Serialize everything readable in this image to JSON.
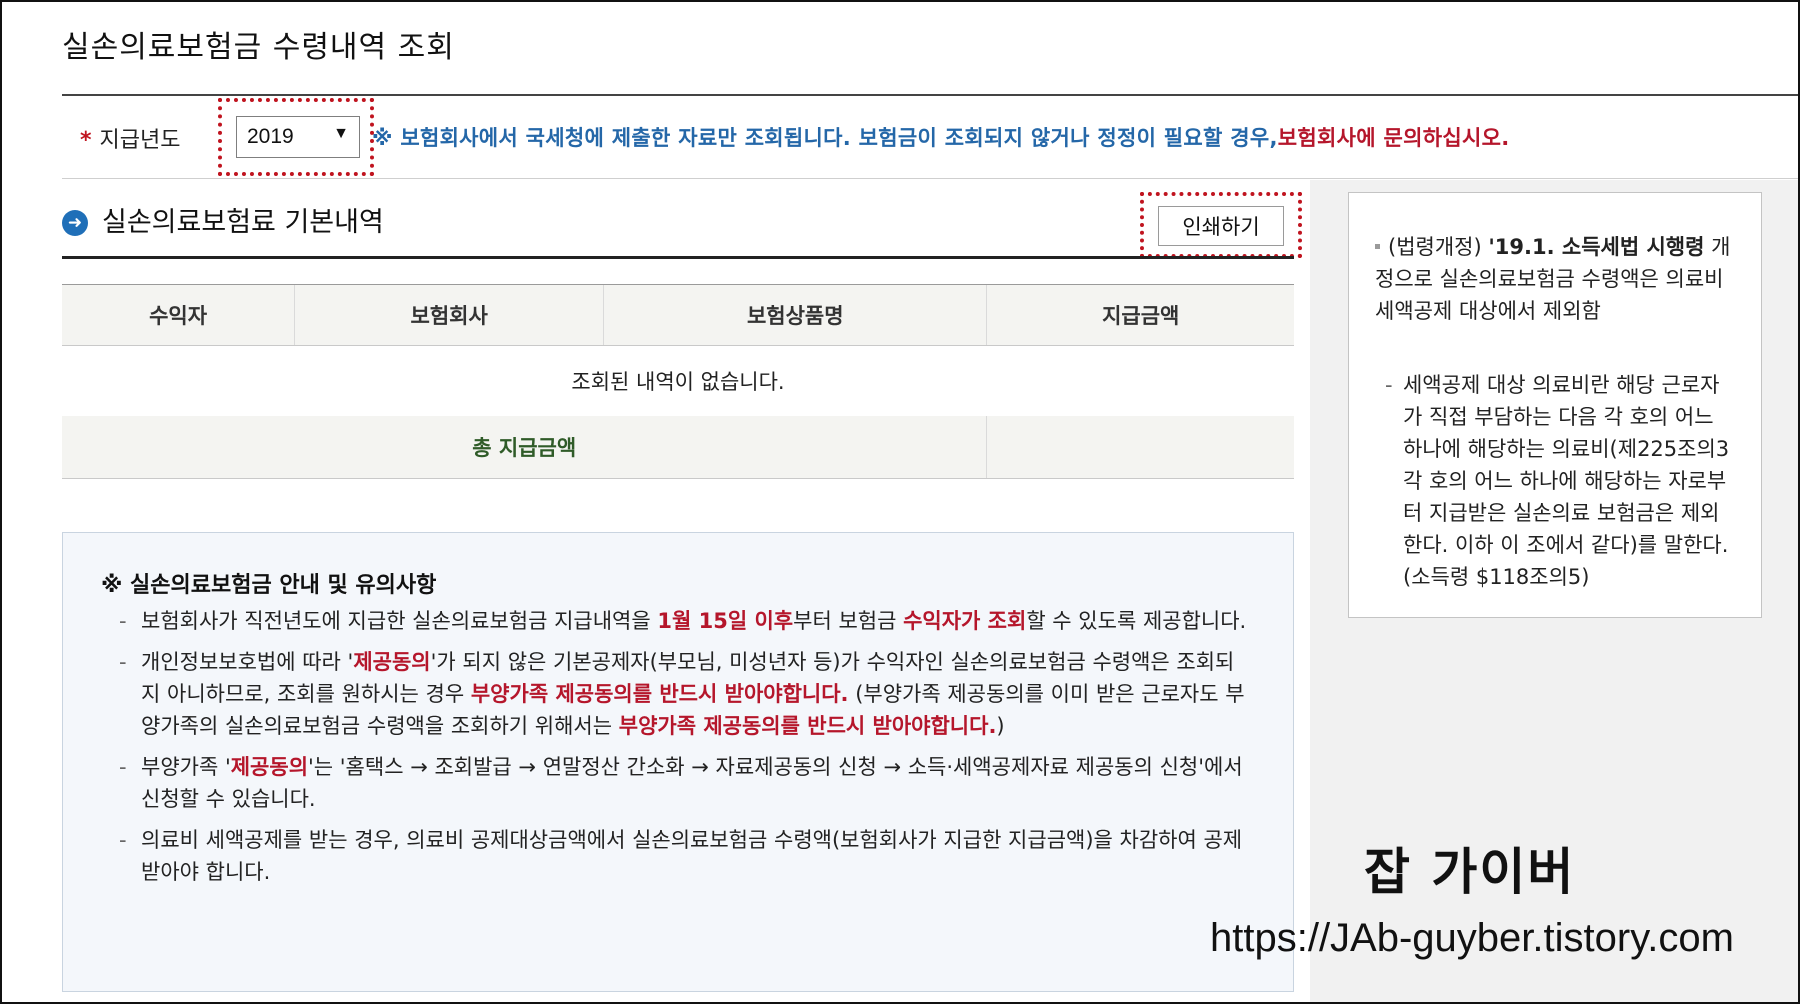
{
  "page": {
    "title": "실손의료보험금 수령내역 조회"
  },
  "filter": {
    "required_mark": "*",
    "label": "지급년도",
    "year_value": "2019",
    "dropdown_arrow": "▼",
    "notice_main": "※ 보험회사에서 국세청에 제출한 자료만 조회됩니다. 보험금이 조회되지 않거나 정정이 필요할 경우,",
    "notice_red": "보험회사에 문의하십시오."
  },
  "section": {
    "bullet_icon": "arrow-right-circle",
    "bullet_glyph": "➜",
    "title": "실손의료보험료 기본내역",
    "print_label": "인쇄하기"
  },
  "table": {
    "headers": [
      "수익자",
      "보험회사",
      "보험상품명",
      "지급금액"
    ],
    "empty_message": "조회된 내역이 없습니다.",
    "total_label": "총 지급금액",
    "total_value": ""
  },
  "notes": {
    "title": "※ 실손의료보험금 안내 및 유의사항",
    "items": [
      {
        "p1": "보험회사가 직전년도에 지급한 실손의료보험금 지급내역을 ",
        "r1": "1월 15일 이후",
        "p2": "부터 보험금 ",
        "r2": "수익자가 조회",
        "p3": "할 수 있도록 제공합니다."
      },
      {
        "p1": "개인정보보호법에 따라 '",
        "r1": "제공동의",
        "p2": "'가 되지 않은 기본공제자(부모님, 미성년자 등)가 수익자인 실손의료보험금 수령액은 조회되지 아니하므로, 조회를 원하시는 경우 ",
        "r2": "부양가족 제공동의를 반드시 받아야합니다.",
        "p3": " (부양가족 제공동의를 이미 받은 근로자도 부양가족의 실손의료보험금 수령액을 조회하기 위해서는 ",
        "r3": "부양가족 제공동의를 반드시 받아야합니다.",
        "p4": ")"
      },
      {
        "p1": "부양가족 '",
        "r1": "제공동의",
        "p2": "'는 '홈택스 → 조회발급 → 연말정산 간소화 → 자료제공동의 신청 → 소득·세액공제자료 제공동의 신청'에서 신청할 수 있습니다."
      },
      {
        "p1": "의료비 세액공제를 받는 경우, 의료비 공제대상금액에서 실손의료보험금 수령액(보험회사가 지급한 지급금액)을 차감하여 공제받아야 합니다."
      }
    ]
  },
  "side": {
    "item_p1": "(법령개정) ",
    "item_bold": "'19.1. 소득세법 시행령",
    "item_p2": " 개정으로 실손의료보험금 수령액은 의료비 세액공제 대상에서 제외함",
    "sub": "세액공제 대상 의료비란 해당 근로자가 직접 부담하는 다음 각 호의 어느 하나에 해당하는 의료비(제225조의3 각 호의 어느 하나에 해당하는 자로부터 지급받은 실손의료 보험금은 제외한다. 이하 이 조에서 같다)를 말한다. (소득령 $118조의5)"
  },
  "watermark": {
    "name": "잡 가이버",
    "url": "https://JAb-guyber.tistory.com"
  },
  "colors": {
    "accent_blue": "#2467a8",
    "emphasis_red": "#b5162b",
    "highlight_dotted": "#c0141f"
  }
}
